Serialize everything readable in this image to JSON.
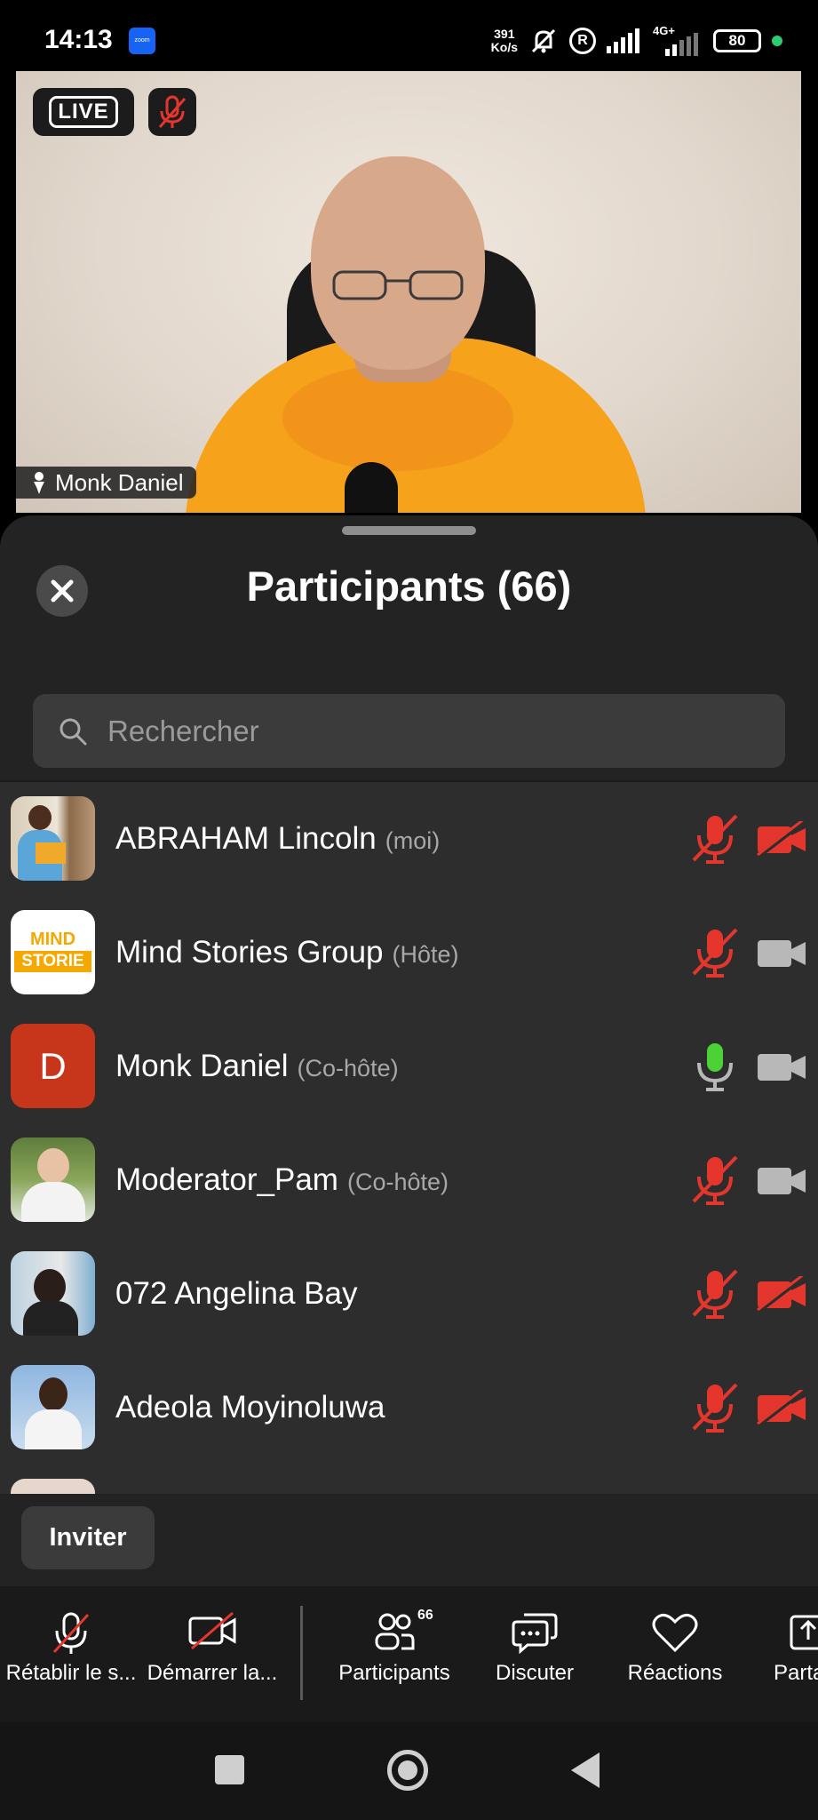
{
  "status_bar": {
    "time": "14:13",
    "app_icon_label": "zoom",
    "net_speed_value": "391",
    "net_speed_unit": "Ko/s",
    "network_label": "4G+",
    "battery": "80",
    "icons": [
      "zoom-app-icon",
      "mute-bell-icon",
      "r-icon",
      "signal-icon",
      "signal-4g-icon",
      "battery-icon"
    ]
  },
  "video": {
    "live_label": "LIVE",
    "speaker_name": "Monk Daniel",
    "icons": [
      "mic-muted-icon",
      "spotlight-pin-icon"
    ]
  },
  "panel": {
    "title": "Participants (66)",
    "search_placeholder": "Rechercher",
    "icons": [
      "close-icon",
      "search-icon"
    ]
  },
  "participants": [
    {
      "name": "ABRAHAM Lincoln",
      "role": "(moi)",
      "avatar": "photo",
      "mic": "muted",
      "camera": "off"
    },
    {
      "name": "Mind Stories Group",
      "role": "(Hôte)",
      "avatar": "logo",
      "avatar_text_1": "MIND",
      "avatar_text_2": "STORIE",
      "mic": "muted",
      "camera": "on"
    },
    {
      "name": "Monk Daniel",
      "role": "(Co-hôte)",
      "avatar": "letter",
      "avatar_letter": "D",
      "avatar_color": "#c7361a",
      "mic": "active",
      "camera": "on"
    },
    {
      "name": "Moderator_Pam",
      "role": "(Co-hôte)",
      "avatar": "photo",
      "mic": "muted",
      "camera": "on"
    },
    {
      "name": "072 Angelina Bay",
      "role": "",
      "avatar": "photo",
      "mic": "muted",
      "camera": "off"
    },
    {
      "name": "Adeola Moyinoluwa",
      "role": "",
      "avatar": "photo",
      "mic": "muted",
      "camera": "off"
    }
  ],
  "invite": {
    "label": "Inviter"
  },
  "toolbar": {
    "unmute": "Rétablir le s...",
    "start_video": "Démarrer la...",
    "participants": "Participants",
    "participants_count": "66",
    "chat": "Discuter",
    "reactions": "Réactions",
    "share": "Partager"
  },
  "colors": {
    "muted_red": "#e5362e",
    "active_green": "#4cd137",
    "camera_on_grey": "#b8b8b8",
    "panel_bg": "#232323",
    "list_bg": "#2d2d2d"
  }
}
